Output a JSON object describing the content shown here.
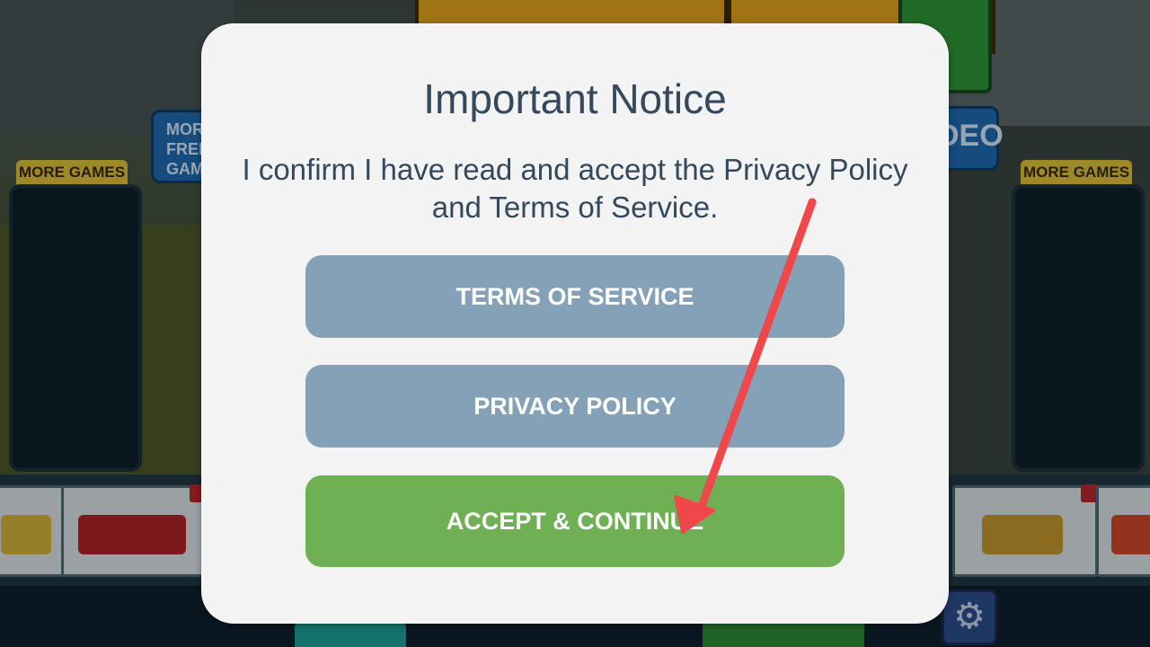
{
  "background": {
    "more_games_left": "MORE GAMES",
    "more_games_right": "MORE GAMES",
    "free_games_button": "MORE FREE GAMES",
    "video_button": "DEO"
  },
  "dialog": {
    "title": "Important Notice",
    "message": "I confirm I have read and accept the Privacy Policy and Terms of Service.",
    "buttons": {
      "terms_of_service": "TERMS OF SERVICE",
      "privacy_policy": "PRIVACY POLICY",
      "accept_continue": "ACCEPT & CONTINUE"
    }
  },
  "icons": {
    "settings": "gear-icon",
    "annotation": "red-arrow"
  },
  "colors": {
    "dialog_background": "#f3f3f3",
    "text": "#34495e",
    "secondary_button": "#84a1b8",
    "primary_button": "#6fb054",
    "annotation_arrow": "#f0474b"
  }
}
